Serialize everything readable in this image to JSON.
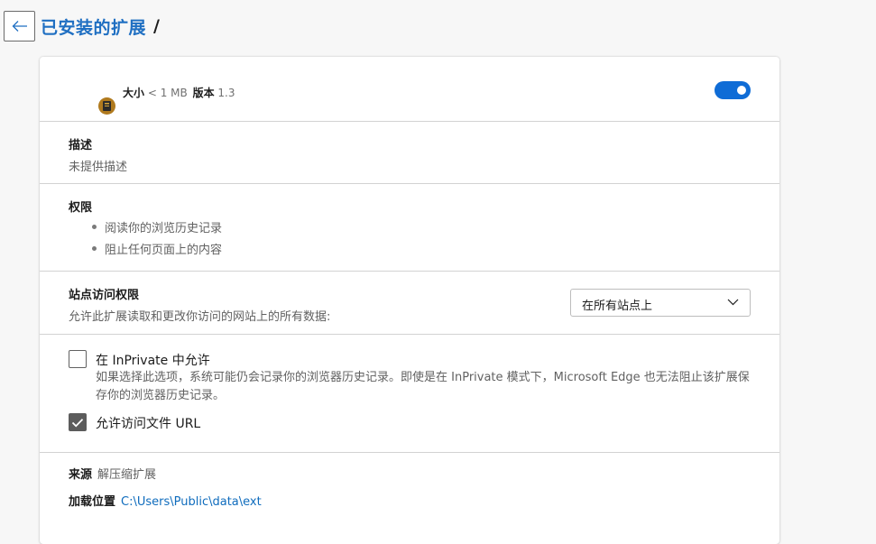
{
  "header": {
    "title": "已安装的扩展",
    "separator": "/"
  },
  "extension": {
    "size_label": "大小",
    "size_value": "< 1 MB",
    "version_label": "版本",
    "version_value": "1.3",
    "enabled": true
  },
  "description": {
    "heading": "描述",
    "text": "未提供描述"
  },
  "permissions": {
    "heading": "权限",
    "items": [
      "阅读你的浏览历史记录",
      "阻止任何页面上的内容"
    ]
  },
  "site_access": {
    "heading": "站点访问权限",
    "text": "允许此扩展读取和更改你访问的网站上的所有数据:",
    "selected": "在所有站点上"
  },
  "options": {
    "inprivate_label": "在 InPrivate 中允许",
    "inprivate_checked": false,
    "inprivate_desc": "如果选择此选项，系统可能仍会记录你的浏览器历史记录。即使是在 InPrivate 模式下，Microsoft Edge 也无法阻止该扩展保存你的浏览器历史记录。",
    "file_url_label": "允许访问文件 URL",
    "file_url_checked": true
  },
  "source": {
    "label": "来源",
    "value": "解压缩扩展",
    "location_label": "加载位置",
    "location_value": "C:\\Users\\Public\\data\\ext"
  },
  "colors": {
    "accent": "#0f6cd6",
    "title": "#1f6fc2",
    "link": "#0f6cbd"
  },
  "icons": [
    "back-arrow-icon",
    "extension-icon",
    "chevron-down-icon",
    "checkmark-icon"
  ]
}
